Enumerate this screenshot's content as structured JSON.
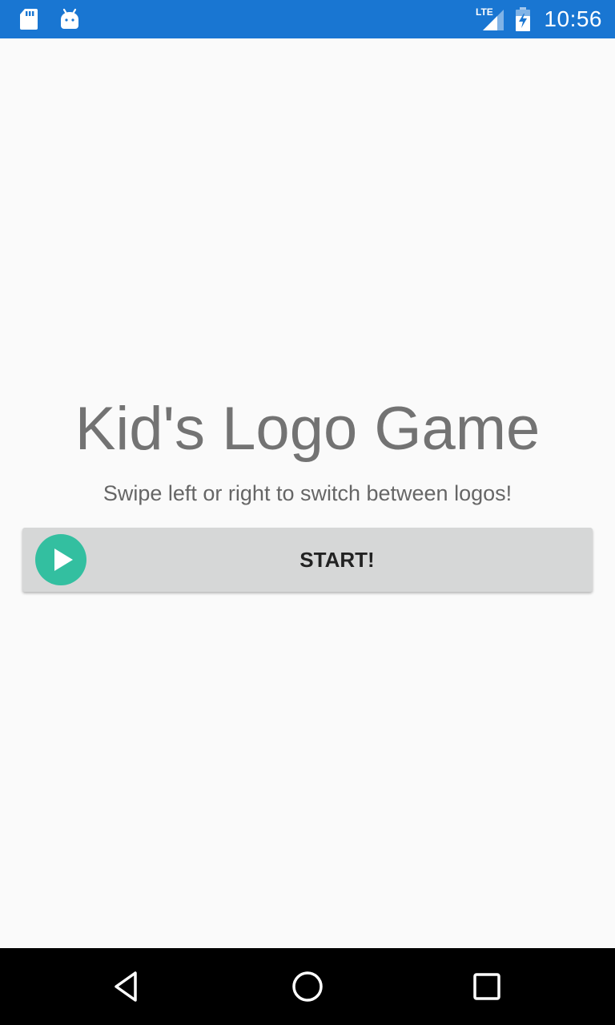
{
  "status_bar": {
    "time": "10:56",
    "network": "LTE",
    "color": "#1976d2",
    "icons": [
      "sd-card-icon",
      "android-icon",
      "lte-signal-icon",
      "battery-charging-icon"
    ]
  },
  "main": {
    "title": "Kid's Logo Game",
    "subtitle": "Swipe left or right to switch between logos!",
    "start_button": {
      "label": "START!",
      "icon": "play-circle-icon",
      "icon_color": "#33bfa0"
    }
  },
  "nav_bar": {
    "back": "back-icon",
    "home": "home-icon",
    "recents": "recents-icon"
  }
}
